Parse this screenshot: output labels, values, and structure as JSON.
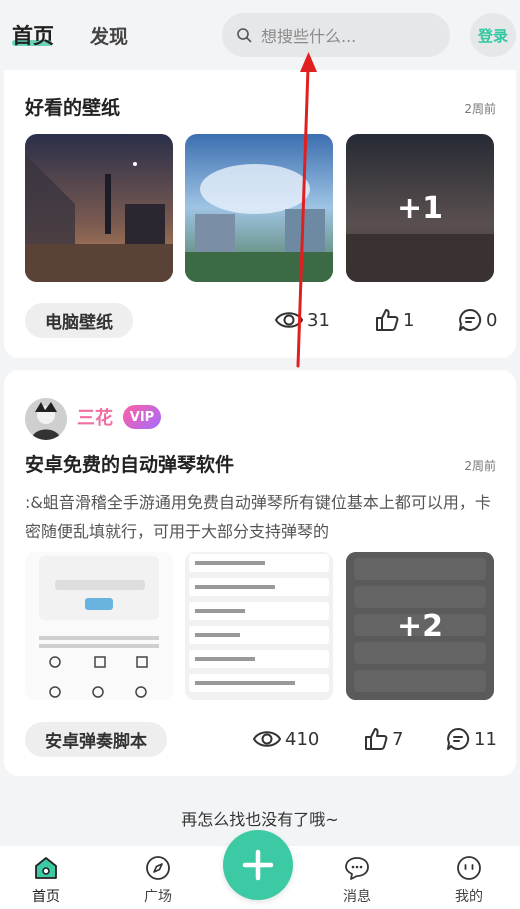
{
  "header": {
    "tab_home": "首页",
    "tab_discover": "发现",
    "search_placeholder": "想搜些什么...",
    "login_label": "登录"
  },
  "post1": {
    "title": "好看的壁纸",
    "time": "2周前",
    "more_overlay": "+1",
    "tag": "电脑壁纸",
    "views": "31",
    "likes": "1",
    "comments": "0"
  },
  "post2": {
    "username": "三花",
    "vip_label": "VIP",
    "title": "安卓免费的自动弹琴软件",
    "time": "2周前",
    "body": ":&蛆音滑稽全手游通用免费自动弹琴所有键位基本上都可以用，卡密随便乱填就行，可用于大部分支持弹琴的",
    "more_overlay": "+2",
    "tag": "安卓弹奏脚本",
    "views": "410",
    "likes": "7",
    "comments": "11"
  },
  "end_text": "再怎么找也没有了哦~",
  "nav": {
    "home": "首页",
    "square": "广场",
    "messages": "消息",
    "mine": "我的"
  },
  "colors": {
    "accent": "#3ccaa4",
    "vip_pink": "#ef6fa3",
    "annotation_arrow": "#e02020"
  }
}
